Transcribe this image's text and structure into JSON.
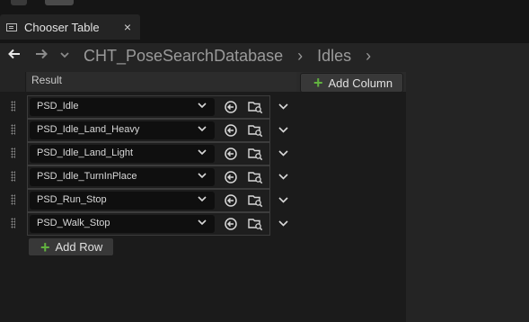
{
  "tab": {
    "title": "Chooser Table",
    "close_glyph": "×",
    "icon": "table-icon"
  },
  "breadcrumb": {
    "back_glyph": "🡐",
    "forward_glyph": "🡒",
    "history_glyph": "⌄",
    "items": [
      "CHT_PoseSearchDatabase",
      "Idles"
    ],
    "separator": "›"
  },
  "table": {
    "column_header": "Result",
    "add_column_label": "Add Column",
    "add_row_label": "Add Row",
    "rows": [
      {
        "value": "PSD_Idle"
      },
      {
        "value": "PSD_Idle_Land_Heavy"
      },
      {
        "value": "PSD_Idle_Land_Light"
      },
      {
        "value": "PSD_Idle_TurnInPlace"
      },
      {
        "value": "PSD_Run_Stop"
      },
      {
        "value": "PSD_Walk_Stop"
      }
    ]
  },
  "colors": {
    "accent_add": "#62b23f",
    "background": "#1b1b1b",
    "panel": "#242424"
  }
}
